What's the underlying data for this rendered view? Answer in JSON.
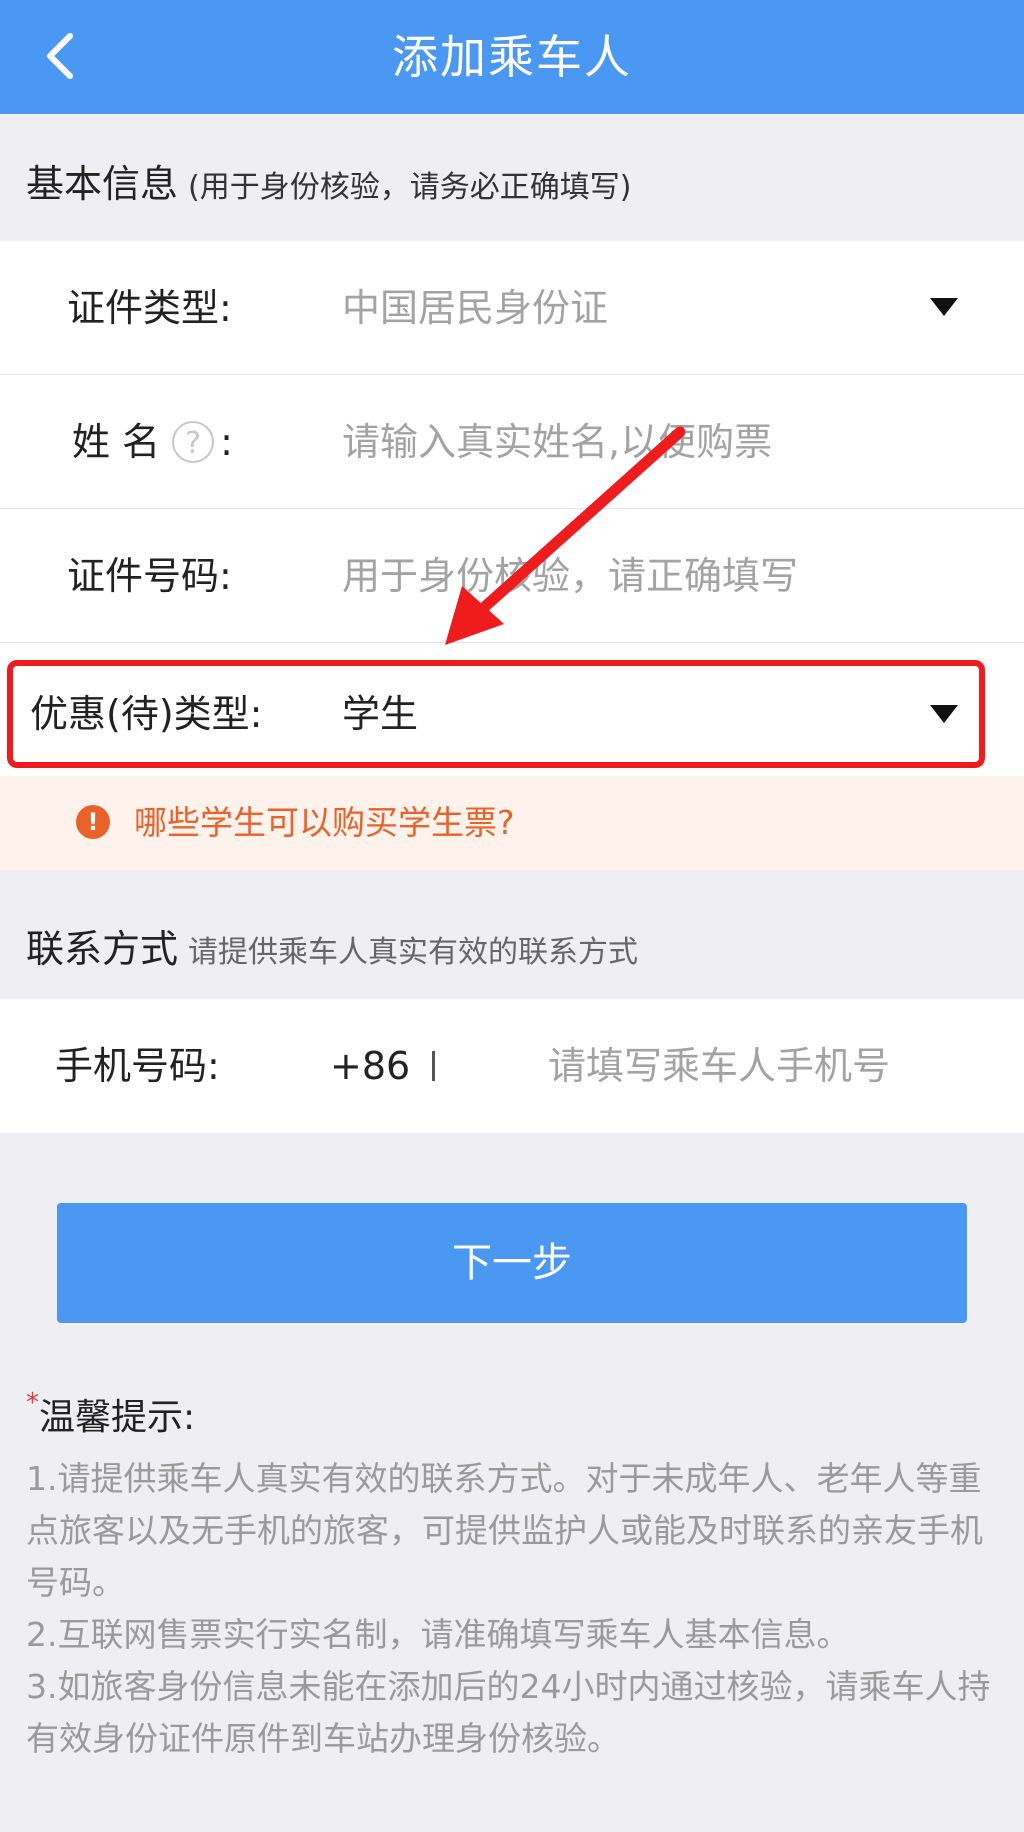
{
  "header": {
    "title": "添加乘车人"
  },
  "basic_section": {
    "title": "基本信息",
    "note": "(用于身份核验，请务必正确填写)"
  },
  "fields": {
    "id_type": {
      "label": "证件类型:",
      "value": "中国居民身份证"
    },
    "name": {
      "label_part1": "姓 名",
      "help": "?",
      "colon": ":",
      "placeholder": "请输入真实姓名,以便购票"
    },
    "id_number": {
      "label": "证件号码:",
      "placeholder": "用于身份核验，请正确填写"
    },
    "discount_type": {
      "label": "优惠(待)类型:",
      "value": "学生"
    }
  },
  "notice": {
    "icon": "!",
    "text": "哪些学生可以购买学生票?"
  },
  "contact_section": {
    "title": "联系方式",
    "note": "请提供乘车人真实有效的联系方式"
  },
  "phone": {
    "label": "手机号码:",
    "country_code": "+86",
    "placeholder": "请填写乘车人手机号"
  },
  "next_button": {
    "label": "下一步"
  },
  "tips": {
    "star": "*",
    "title": "温馨提示:",
    "items": [
      "1.请提供乘车人真实有效的联系方式。对于未成年人、老年人等重点旅客以及无手机的旅客，可提供监护人或能及时联系的亲友手机号码。",
      "2.互联网售票实行实名制，请准确填写乘车人基本信息。",
      "3.如旅客身份信息未能在添加后的24小时内通过核验，请乘车人持有效身份证件原件到车站办理身份核验。"
    ]
  },
  "colors": {
    "header_bg": "#4a98f1",
    "highlight": "#ee1c1c",
    "notice_text": "#e8622a",
    "notice_bg": "#fdf3ec",
    "page_bg": "#eeeef3"
  }
}
